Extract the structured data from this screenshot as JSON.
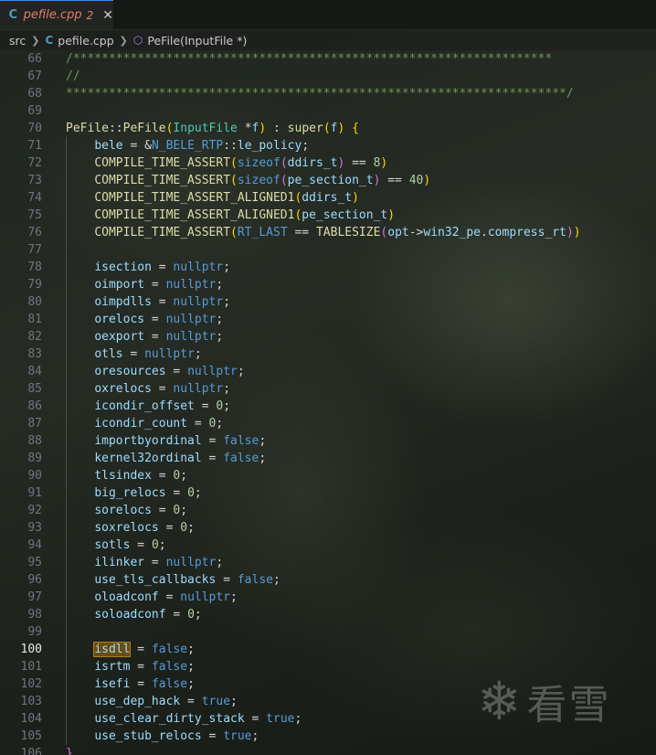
{
  "tab": {
    "icon": "cpp-file-icon",
    "name": "pefile.cpp",
    "problems": "2",
    "close": "✕"
  },
  "breadcrumb": {
    "folder": "src",
    "file": "pefile.cpp",
    "symbol": "PeFile(InputFile *)"
  },
  "editor": {
    "active_line": "100",
    "lines": [
      {
        "n": "66",
        "src": "/*******************************************************************"
      },
      {
        "n": "67",
        "src": "//"
      },
      {
        "n": "68",
        "src": "**********************************************************************/"
      },
      {
        "n": "69",
        "src": ""
      },
      {
        "n": "70",
        "src": "PeFile::PeFile(InputFile *f) : super(f) {"
      },
      {
        "n": "71",
        "src": "    bele = &N_BELE_RTP::le_policy;"
      },
      {
        "n": "72",
        "src": "    COMPILE_TIME_ASSERT(sizeof(ddirs_t) == 8)"
      },
      {
        "n": "73",
        "src": "    COMPILE_TIME_ASSERT(sizeof(pe_section_t) == 40)"
      },
      {
        "n": "74",
        "src": "    COMPILE_TIME_ASSERT_ALIGNED1(ddirs_t)"
      },
      {
        "n": "75",
        "src": "    COMPILE_TIME_ASSERT_ALIGNED1(pe_section_t)"
      },
      {
        "n": "76",
        "src": "    COMPILE_TIME_ASSERT(RT_LAST == TABLESIZE(opt->win32_pe.compress_rt))"
      },
      {
        "n": "77",
        "src": ""
      },
      {
        "n": "78",
        "src": "    isection = nullptr;"
      },
      {
        "n": "79",
        "src": "    oimport = nullptr;"
      },
      {
        "n": "80",
        "src": "    oimpdlls = nullptr;"
      },
      {
        "n": "81",
        "src": "    orelocs = nullptr;"
      },
      {
        "n": "82",
        "src": "    oexport = nullptr;"
      },
      {
        "n": "83",
        "src": "    otls = nullptr;"
      },
      {
        "n": "84",
        "src": "    oresources = nullptr;"
      },
      {
        "n": "85",
        "src": "    oxrelocs = nullptr;"
      },
      {
        "n": "86",
        "src": "    icondir_offset = 0;"
      },
      {
        "n": "87",
        "src": "    icondir_count = 0;"
      },
      {
        "n": "88",
        "src": "    importbyordinal = false;"
      },
      {
        "n": "89",
        "src": "    kernel32ordinal = false;"
      },
      {
        "n": "90",
        "src": "    tlsindex = 0;"
      },
      {
        "n": "91",
        "src": "    big_relocs = 0;"
      },
      {
        "n": "92",
        "src": "    sorelocs = 0;"
      },
      {
        "n": "93",
        "src": "    soxrelocs = 0;"
      },
      {
        "n": "94",
        "src": "    sotls = 0;"
      },
      {
        "n": "95",
        "src": "    ilinker = nullptr;"
      },
      {
        "n": "96",
        "src": "    use_tls_callbacks = false;"
      },
      {
        "n": "97",
        "src": "    oloadconf = nullptr;"
      },
      {
        "n": "98",
        "src": "    soloadconf = 0;"
      },
      {
        "n": "99",
        "src": ""
      },
      {
        "n": "100",
        "src": "    isdll = false;"
      },
      {
        "n": "101",
        "src": "    isrtm = false;"
      },
      {
        "n": "102",
        "src": "    isefi = false;"
      },
      {
        "n": "103",
        "src": "    use_dep_hack = true;"
      },
      {
        "n": "104",
        "src": "    use_clear_dirty_stack = true;"
      },
      {
        "n": "105",
        "src": "    use_stub_relocs = true;"
      },
      {
        "n": "106",
        "src": "}"
      }
    ]
  },
  "watermark": {
    "icon": "snowflake-icon",
    "text": "看雪"
  },
  "colors": {
    "keyword": "#569cd6",
    "function": "#dcdcaa",
    "type": "#4ec9b0",
    "variable": "#9cdcfe",
    "number": "#b5cea8",
    "comment": "#6a9955",
    "tab_modified": "#e37d6e"
  }
}
